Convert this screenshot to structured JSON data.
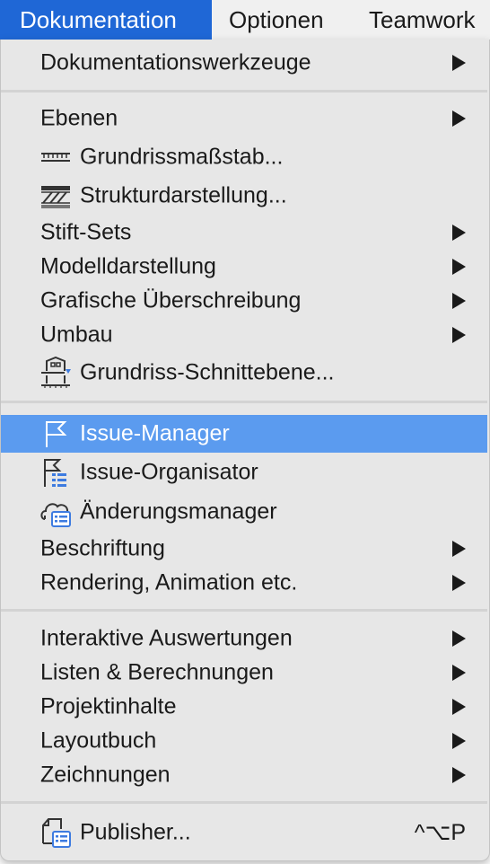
{
  "menubar": {
    "items": [
      {
        "label": "Dokumentation",
        "active": true
      },
      {
        "label": "Optionen",
        "active": false
      },
      {
        "label": "Teamwork",
        "active": false
      }
    ]
  },
  "menu": {
    "items": [
      {
        "label": "Dokumentationswerkzeuge",
        "submenu": true
      },
      {
        "label": "Ebenen",
        "submenu": true
      },
      {
        "label": "Grundrissmaßstab...",
        "icon": "ruler-icon"
      },
      {
        "label": "Strukturdarstellung...",
        "icon": "hatch-pattern-icon"
      },
      {
        "label": "Stift-Sets",
        "submenu": true
      },
      {
        "label": "Modelldarstellung",
        "submenu": true
      },
      {
        "label": "Grafische Überschreibung",
        "submenu": true
      },
      {
        "label": "Umbau",
        "submenu": true
      },
      {
        "label": "Grundriss-Schnittebene...",
        "icon": "building-cut-plane-icon"
      },
      {
        "label": "Issue-Manager",
        "icon": "flag-icon",
        "highlighted": true
      },
      {
        "label": "Issue-Organisator",
        "icon": "flag-list-icon"
      },
      {
        "label": "Änderungsmanager",
        "icon": "cloud-list-icon"
      },
      {
        "label": "Beschriftung",
        "submenu": true
      },
      {
        "label": "Rendering, Animation etc.",
        "submenu": true
      },
      {
        "label": "Interaktive Auswertungen",
        "submenu": true
      },
      {
        "label": "Listen & Berechnungen",
        "submenu": true
      },
      {
        "label": "Projektinhalte",
        "submenu": true
      },
      {
        "label": "Layoutbuch",
        "submenu": true
      },
      {
        "label": "Zeichnungen",
        "submenu": true
      },
      {
        "label": "Publisher...",
        "icon": "publisher-icon",
        "shortcut": "^⌥P"
      }
    ]
  },
  "colors": {
    "menubar_active": "#1f67d6",
    "highlight": "#5b9bef",
    "menu_background": "#e7e7e7",
    "icon_accent": "#3d7be0"
  }
}
